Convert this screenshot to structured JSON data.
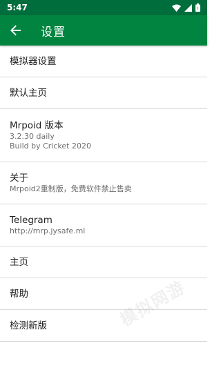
{
  "status_bar": {
    "time": "5:47",
    "icons": [
      "wifi-icon",
      "signal-icon",
      "battery-icon"
    ]
  },
  "app_bar": {
    "title": "设置",
    "back_icon": "arrow-back-icon",
    "color": "#00843f"
  },
  "settings": {
    "emulator": {
      "title": "模拟器设置"
    },
    "default_home": {
      "title": "默认主页"
    },
    "version": {
      "title": "Mrpoid 版本",
      "line1": "3.2.30 daily",
      "line2": "Build by Cricket 2020"
    },
    "about": {
      "title": "关于",
      "subtitle": "Mrpoid2重制版，免费软件禁止售卖"
    },
    "telegram": {
      "title": "Telegram",
      "subtitle": "http://mrp.jysafe.ml"
    },
    "home": {
      "title": "主页"
    },
    "help": {
      "title": "帮助"
    },
    "check_update": {
      "title": "检测新版"
    }
  },
  "watermark": "模拟网游"
}
